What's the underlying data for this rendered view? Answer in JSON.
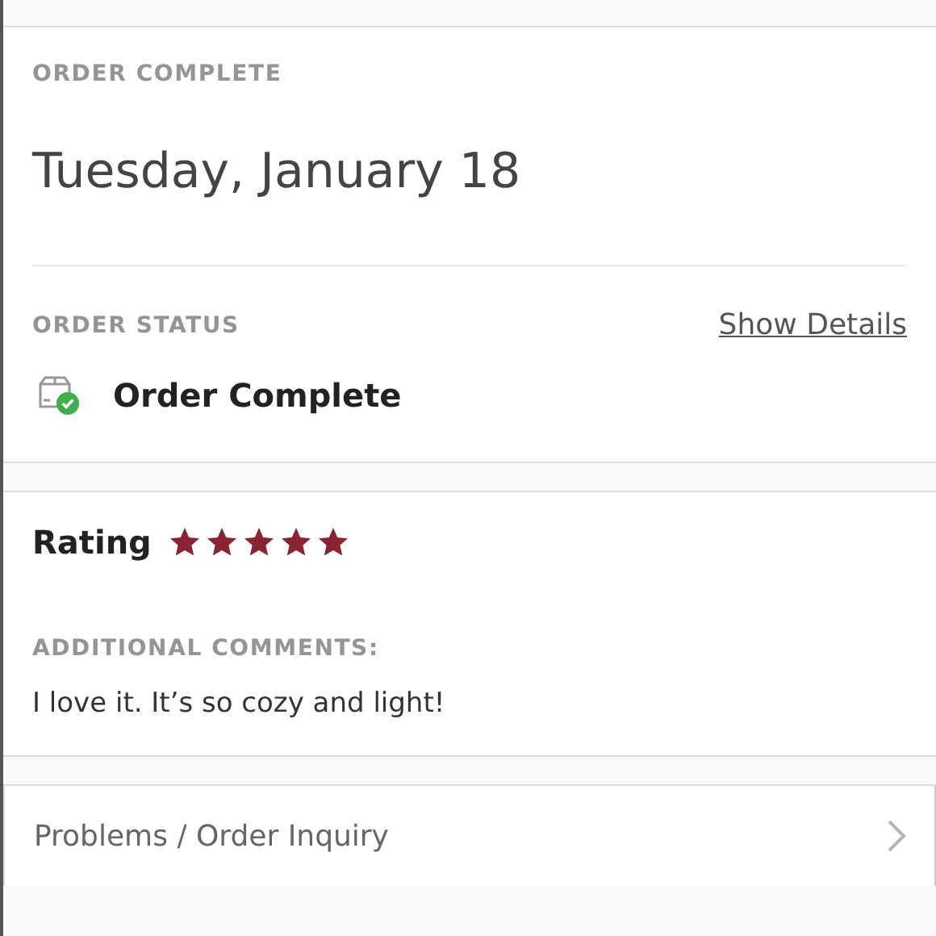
{
  "order": {
    "label": "ORDER COMPLETE",
    "date": "Tuesday, January 18"
  },
  "status": {
    "label": "ORDER STATUS",
    "link": "Show Details",
    "text": "Order Complete"
  },
  "rating": {
    "label": "Rating",
    "stars": 5
  },
  "comments": {
    "label": "ADDITIONAL COMMENTS:",
    "text": "I love it. It’s so cozy and light!"
  },
  "inquiry": {
    "label": "Problems / Order Inquiry"
  }
}
